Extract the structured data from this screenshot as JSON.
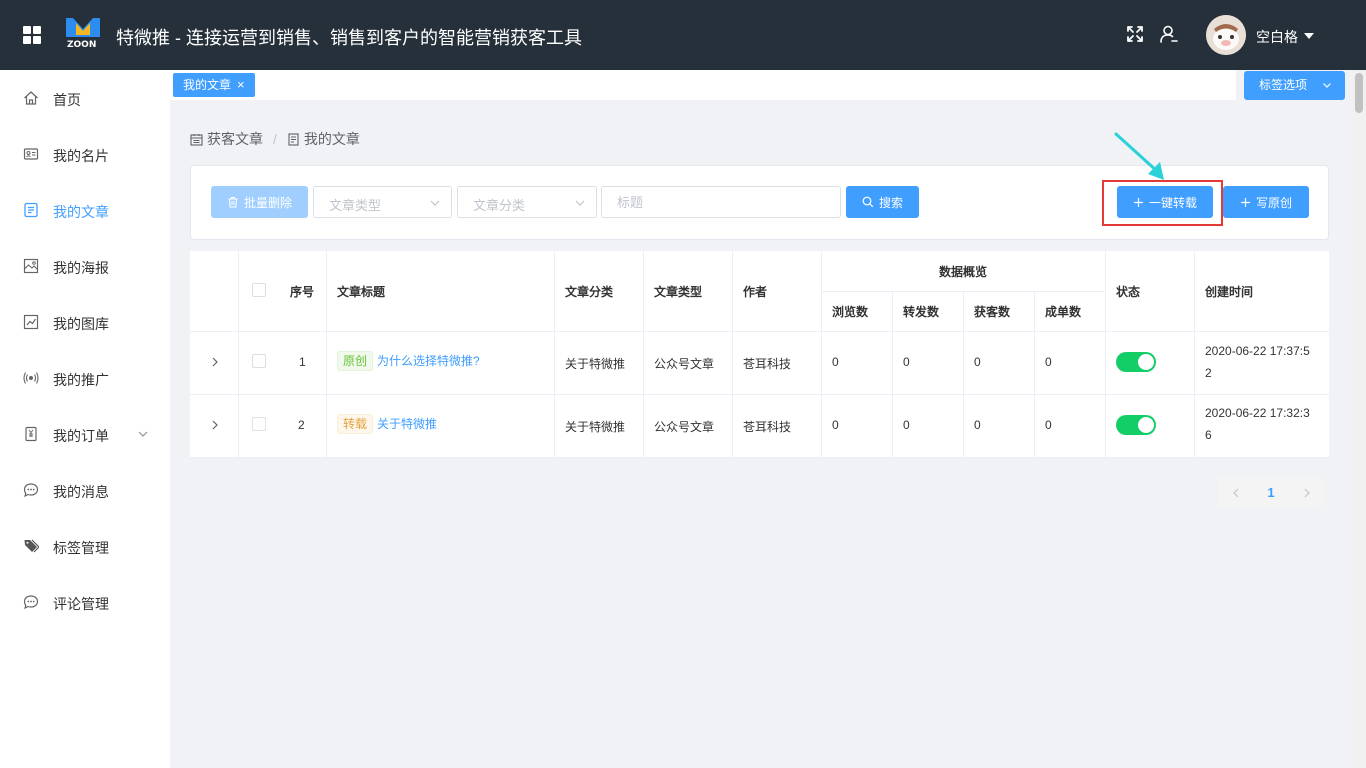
{
  "header": {
    "title": "特微推 - 连接运营到销售、销售到客户的智能营销获客工具",
    "logo_letters": "ZOON",
    "user_name": "空白格"
  },
  "sidebar": {
    "items": [
      {
        "label": "首页",
        "icon": "home-icon"
      },
      {
        "label": "我的名片",
        "icon": "id-card-icon"
      },
      {
        "label": "我的文章",
        "icon": "document-icon",
        "active": true
      },
      {
        "label": "我的海报",
        "icon": "image-icon"
      },
      {
        "label": "我的图库",
        "icon": "chart-icon"
      },
      {
        "label": "我的推广",
        "icon": "broadcast-icon"
      },
      {
        "label": "我的订单",
        "icon": "order-icon",
        "has_children": true
      },
      {
        "label": "我的消息",
        "icon": "message-icon"
      },
      {
        "label": "标签管理",
        "icon": "tag-icon"
      },
      {
        "label": "评论管理",
        "icon": "comment-icon"
      }
    ]
  },
  "tabs": {
    "active_tab": "我的文章",
    "options_label": "标签选项"
  },
  "breadcrumb": {
    "parent": "获客文章",
    "current": "我的文章"
  },
  "toolbar": {
    "batch_delete": "批量删除",
    "article_type_placeholder": "文章类型",
    "article_category_placeholder": "文章分类",
    "title_placeholder": "标题",
    "search": "搜索",
    "one_click_repost": "一键转载",
    "write_original": "写原创"
  },
  "table": {
    "headers": {
      "index": "序号",
      "title": "文章标题",
      "category": "文章分类",
      "type": "文章类型",
      "author": "作者",
      "data_overview": "数据概览",
      "views": "浏览数",
      "shares": "转发数",
      "leads": "获客数",
      "orders": "成单数",
      "status": "状态",
      "created": "创建时间"
    },
    "rows": [
      {
        "index": "1",
        "tag": "原创",
        "title": "为什么选择特微推?",
        "category": "关于特微推",
        "type": "公众号文章",
        "author": "苍耳科技",
        "views": "0",
        "shares": "0",
        "leads": "0",
        "orders": "0",
        "status_on": true,
        "created_line1": "2020-06-22 17:37:5",
        "created_line2": "2"
      },
      {
        "index": "2",
        "tag": "转载",
        "title": "关于特微推",
        "category": "关于特微推",
        "type": "公众号文章",
        "author": "苍耳科技",
        "views": "0",
        "shares": "0",
        "leads": "0",
        "orders": "0",
        "status_on": true,
        "created_line1": "2020-06-22 17:32:3",
        "created_line2": "6"
      }
    ]
  },
  "pagination": {
    "current_page": "1"
  },
  "colors": {
    "header_bg": "#26303b",
    "primary": "#409eff",
    "switch_on": "#13ce66",
    "highlight": "#e53935",
    "arrow": "#2ad1d9"
  }
}
